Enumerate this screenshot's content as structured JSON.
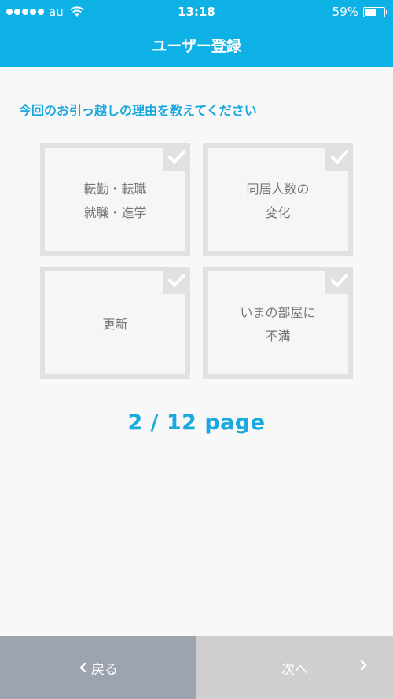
{
  "status_bar": {
    "carrier": "au",
    "time": "13:18",
    "battery_percent_label": "59%",
    "battery_level": 0.59
  },
  "header": {
    "title": "ユーザー登録"
  },
  "question": "今回のお引っ越しの理由を教えてください",
  "options": [
    {
      "label": "転勤・転職\n就職・進学",
      "checked": false
    },
    {
      "label": "同居人数の\n変化",
      "checked": false
    },
    {
      "label": "更新",
      "checked": false
    },
    {
      "label": "いまの部屋に\n不満",
      "checked": false
    }
  ],
  "pager": {
    "text": "2 / 12 page",
    "current": 2,
    "total": 12
  },
  "footer": {
    "back_label": "戻る",
    "next_label": "次へ"
  },
  "colors": {
    "primary": "#0db1e6",
    "accent_text": "#1aa9de",
    "back_button": "#9da4b0",
    "next_button_disabled": "#cfcfcf",
    "option_border": "#e1e1e1"
  },
  "icons": {
    "check": "check-icon",
    "back": "chevron-left-icon",
    "next": "chevron-right-icon",
    "wifi": "wifi-icon",
    "battery": "battery-icon"
  }
}
